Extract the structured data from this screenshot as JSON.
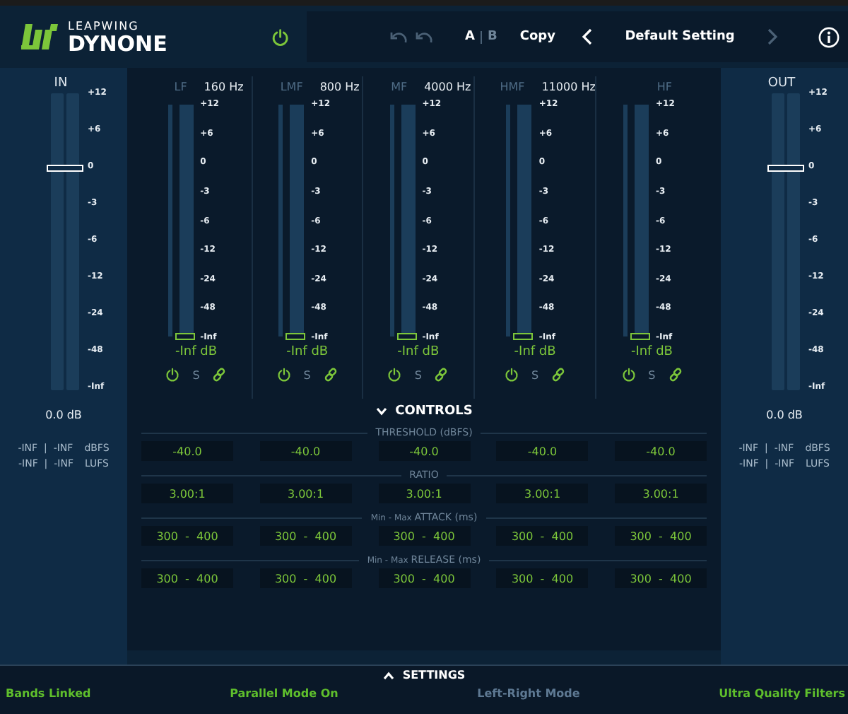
{
  "header": {
    "brand": "LEAPWING",
    "product": "DYNONE",
    "bypass_on": true,
    "undo_enabled": false,
    "redo_enabled": false,
    "ab": [
      {
        "label": "A",
        "selected": true
      },
      {
        "label": "B",
        "selected": false
      }
    ],
    "copy": "Copy",
    "prev_enabled": true,
    "preset": "Default Setting",
    "next_enabled": false
  },
  "input": {
    "label": "IN",
    "scale": [
      "+12",
      "+6",
      "0",
      "-3",
      "-6",
      "-12",
      "-24",
      "-48",
      "-Inf"
    ],
    "level": 0.75,
    "gain": "0.0 dB",
    "readings": [
      {
        "values": "-INF  |  -INF",
        "unit": "dBFS"
      },
      {
        "values": "-INF  |  -INF",
        "unit": "LUFS"
      }
    ]
  },
  "bands": [
    {
      "name": "LF",
      "frequency": "160 Hz",
      "scale": [
        "+12",
        "+6",
        "0",
        "-3",
        "-6",
        "-12",
        "-24",
        "-48",
        "-Inf"
      ],
      "level": 0,
      "reading": "-Inf dB",
      "on": true,
      "solo_label": "S",
      "solo": false,
      "linked": true
    },
    {
      "name": "LMF",
      "frequency": "800 Hz",
      "scale": [
        "+12",
        "+6",
        "0",
        "-3",
        "-6",
        "-12",
        "-24",
        "-48",
        "-Inf"
      ],
      "level": 0,
      "reading": "-Inf dB",
      "on": true,
      "solo_label": "S",
      "solo": false,
      "linked": true
    },
    {
      "name": "MF",
      "frequency": "4000 Hz",
      "scale": [
        "+12",
        "+6",
        "0",
        "-3",
        "-6",
        "-12",
        "-24",
        "-48",
        "-Inf"
      ],
      "level": 0,
      "reading": "-Inf dB",
      "on": true,
      "solo_label": "S",
      "solo": false,
      "linked": true
    },
    {
      "name": "HMF",
      "frequency": "11000 Hz",
      "scale": [
        "+12",
        "+6",
        "0",
        "-3",
        "-6",
        "-12",
        "-24",
        "-48",
        "-Inf"
      ],
      "level": 0,
      "reading": "-Inf dB",
      "on": true,
      "solo_label": "S",
      "solo": false,
      "linked": true
    },
    {
      "name": "HF",
      "scale": [
        "+12",
        "+6",
        "0",
        "-3",
        "-6",
        "-12",
        "-24",
        "-48",
        "-Inf"
      ],
      "level": 0,
      "reading": "-Inf dB",
      "on": true,
      "solo_label": "S",
      "solo": false,
      "linked": true
    }
  ],
  "controls": {
    "title": "CONTROLS",
    "expanded": true,
    "sections": [
      {
        "label": "THRESHOLD (dBFS)",
        "values": [
          "-40.0",
          "-40.0",
          "-40.0",
          "-40.0",
          "-40.0"
        ]
      },
      {
        "label": "RATIO",
        "values": [
          "3.00:1",
          "3.00:1",
          "3.00:1",
          "3.00:1",
          "3.00:1"
        ]
      },
      {
        "prefix": "Min - Max",
        "label": "ATTACK (ms)",
        "values": [
          "300  -  400",
          "300  -  400",
          "300  -  400",
          "300  -  400",
          "300  -  400"
        ]
      },
      {
        "prefix": "Min - Max",
        "label": "RELEASE (ms)",
        "values": [
          "300  -  400",
          "300  -  400",
          "300  -  400",
          "300  -  400",
          "300  -  400"
        ]
      }
    ]
  },
  "output": {
    "label": "OUT",
    "scale": [
      "+12",
      "+6",
      "0",
      "-3",
      "-6",
      "-12",
      "-24",
      "-48",
      "-Inf"
    ],
    "level": 0.75,
    "gain": "0.0 dB",
    "readings": [
      {
        "values": "-INF  |  -INF",
        "unit": "dBFS"
      },
      {
        "values": "-INF  |  -INF",
        "unit": "LUFS"
      }
    ]
  },
  "settings": {
    "title": "SETTINGS",
    "expanded": false,
    "items": [
      {
        "label": "Bands Linked",
        "on": true
      },
      {
        "label": "Parallel Mode On",
        "on": true
      },
      {
        "label": "Left-Right Mode",
        "on": false
      },
      {
        "label": "Ultra Quality Filters",
        "on": true
      }
    ]
  }
}
